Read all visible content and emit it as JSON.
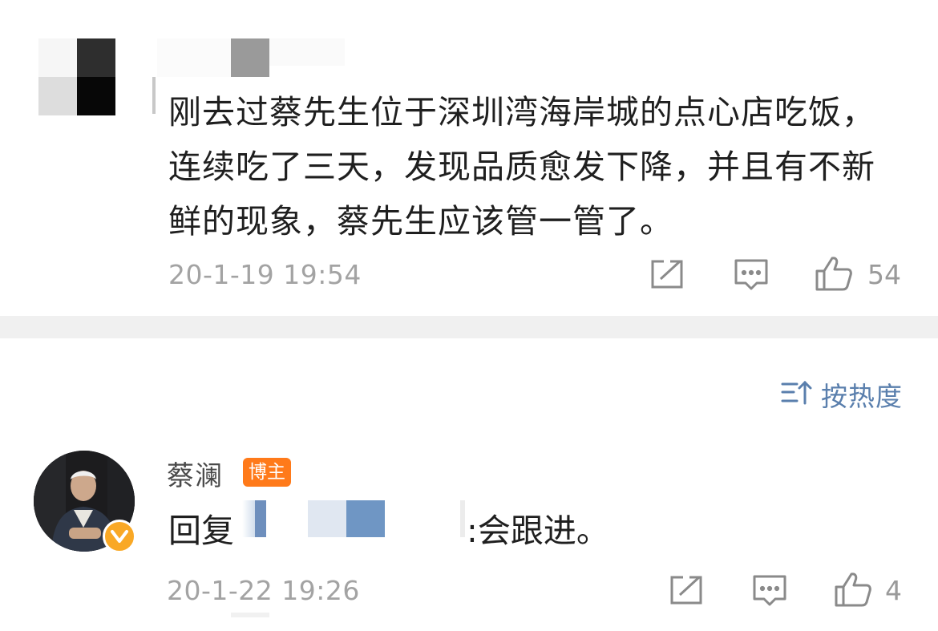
{
  "comment": {
    "text": "刚去过蔡先生位于深圳湾海岸城的点心店吃饭，连续吃了三天，发现品质愈发下降，并且有不新鲜的现象，蔡先生应该管一管了。",
    "timestamp": "20-1-19 19:54",
    "like_count": "54"
  },
  "sort": {
    "label": "按热度",
    "icon": "sort-icon"
  },
  "reply": {
    "author": "蔡澜",
    "badge": "博主",
    "prefix": "回复",
    "suffix": ":会跟进。",
    "timestamp": "20-1-22 19:26",
    "like_count": "4"
  },
  "colors": {
    "link_blue": "#5a7fad",
    "badge_orange": "#ff7a1a",
    "verified_yellow": "#f9a825",
    "divider_gray": "#f0f0f0",
    "meta_gray": "#a3a3a3"
  }
}
